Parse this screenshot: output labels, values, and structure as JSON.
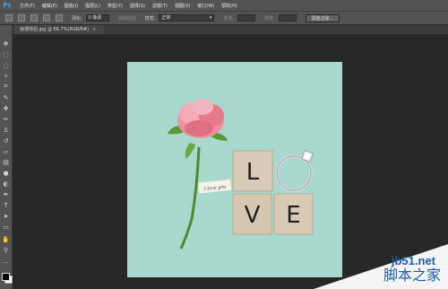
{
  "app": {
    "logo": "Ps"
  },
  "menu": [
    "文件(F)",
    "编辑(E)",
    "图像(I)",
    "图层(L)",
    "类型(Y)",
    "选择(S)",
    "滤镜(T)",
    "视图(V)",
    "窗口(W)",
    "帮助(H)"
  ],
  "options": {
    "feather_label": "羽化:",
    "feather_value": "0 像素",
    "antialias_label": "消除锯齿",
    "style_label": "样式:",
    "style_value": "正常",
    "width_label": "宽度:",
    "height_label": "高度:",
    "refine_edge_button": "调整边缘..."
  },
  "document": {
    "tab_title": "浪漫情侣.jpg @ 66.7%(RGB/8#)",
    "close_symbol": "×"
  },
  "tools": [
    "move-icon",
    "marquee-icon",
    "lasso-icon",
    "magic-wand-icon",
    "crop-icon",
    "eyedropper-icon",
    "healing-brush-icon",
    "brush-icon",
    "clone-stamp-icon",
    "history-brush-icon",
    "eraser-icon",
    "gradient-icon",
    "blur-icon",
    "dodge-icon",
    "pen-icon",
    "type-icon",
    "path-selection-icon",
    "shape-icon",
    "hand-icon",
    "zoom-icon"
  ],
  "image": {
    "tag_text": "I love you",
    "blocks": [
      "L",
      "O",
      "V",
      "E"
    ],
    "background_color": "#a9d8cf"
  },
  "watermark": {
    "site": "jb51.net",
    "name": "脚本之家"
  }
}
